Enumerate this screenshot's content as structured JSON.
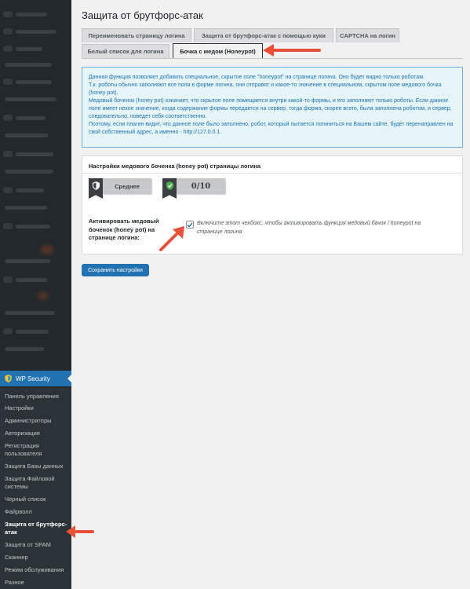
{
  "page": {
    "title": "Защита от брутфорс-атак"
  },
  "tabs": [
    {
      "label": "Переименовать страницу логина",
      "active": false
    },
    {
      "label": "Защита от брутфорс-атак с помощью куки",
      "active": false
    },
    {
      "label": "CAPTCHA на логин",
      "active": false
    },
    {
      "label": "Белый список для логина",
      "active": false
    },
    {
      "label": "Бочка с медом (Honeypot)",
      "active": true
    }
  ],
  "info": {
    "lines": [
      "Данная функция позволяет добавить специальное, скрытое поле \"honeypot\" на странице логина. Оно будет видно только роботам.",
      "Т.к. роботы обычно заполняют все поля в форме логина, они отправят и какое-то значение в специальном, скрытом поле медового бочка (honey pot).",
      "Медовый боченок (honey pot) означает, что скрытое поле помещается внутри какой-то формы, и его заполняют только роботы. Если данное поле имеет некое значение, когда содержание формы передается на сервер, тогда форма, скорее всего, была заполнена роботом, и сервер, следовательно, поведет себя соответственно.",
      "Поэтому, если плагин видит, что данное поле было заполнено, робот, который пытается логиниться на Вашем сайте, будет перенаправлен на свой собственный адрес, а именно - http://127.0.0.1."
    ]
  },
  "settings": {
    "header": "Настройки медового боченка (honey pot) страницы логина",
    "badge_level": "Среднее",
    "badge_score": "0/10",
    "field_label": "Активировать медовый боченок (honey pot) на странице логина:",
    "checkbox_checked": true,
    "checkbox_desc": "Включите этот чекбокс, чтобы активировать функция медовый бачок / honeypot на странице логина"
  },
  "save_button": "Сохранить настройки",
  "sidebar": {
    "plugin_label": "WP Security",
    "items": [
      {
        "label": "Панель управления",
        "current": false
      },
      {
        "label": "Настройки",
        "current": false
      },
      {
        "label": "Администраторы",
        "current": false
      },
      {
        "label": "Авторизация",
        "current": false
      },
      {
        "label": "Регистрация пользователя",
        "current": false
      },
      {
        "label": "Защита Базы данных",
        "current": false
      },
      {
        "label": "Защита Файловой системы",
        "current": false
      },
      {
        "label": "Черный список",
        "current": false
      },
      {
        "label": "Файрволл",
        "current": false
      },
      {
        "label": "Защита от брутфорс-атак",
        "current": true
      },
      {
        "label": "Защита от SPAM",
        "current": false
      },
      {
        "label": "Сканнер",
        "current": false
      },
      {
        "label": "Режим обслуживания",
        "current": false
      },
      {
        "label": "Разное",
        "current": false
      }
    ]
  },
  "colors": {
    "accent": "#2271b1",
    "sidebar": "#23282d",
    "arrow": "#e8503a"
  }
}
